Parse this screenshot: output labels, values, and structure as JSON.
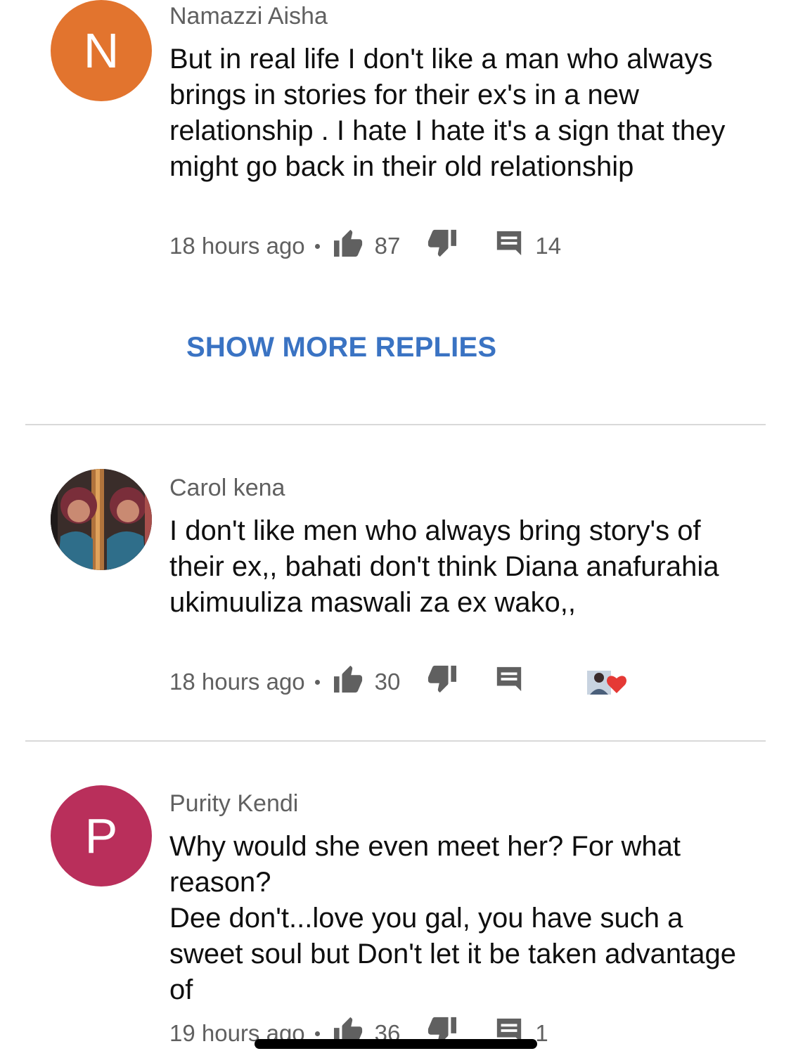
{
  "comments": [
    {
      "author": "Namazzi Aisha",
      "avatar_letter": "N",
      "avatar_color": "#e2742e",
      "text": "But in real life I don't like a man who always brings in stories  for their ex's in a new relationship . I hate I hate it's  a sign that they might go back in their old relationship",
      "time": "18 hours ago",
      "likes": "87",
      "replies": "14"
    },
    {
      "author": "Carol kena",
      "avatar_letter": "",
      "avatar_color": "#5a3b2a",
      "text": "I don't like men who always bring story's of their ex,, bahati don't think Diana anafurahia ukimuuliza  maswali za ex wako,,",
      "time": "18 hours ago",
      "likes": "30",
      "replies": "",
      "creator_heart": "heart-icon"
    },
    {
      "author": "Purity Kendi",
      "avatar_letter": "P",
      "avatar_color": "#b92f5b",
      "text": "Why would she even meet her? For what reason?\nDee don't...love you gal, you have such a sweet soul but Don't let it be taken advantage of",
      "time": "19 hours ago",
      "likes": "36",
      "replies": "1"
    }
  ],
  "show_more_replies": "SHOW MORE REPLIES",
  "colors": {
    "link": "#3a73c3",
    "meta": "#606060",
    "heart": "#e53935"
  }
}
